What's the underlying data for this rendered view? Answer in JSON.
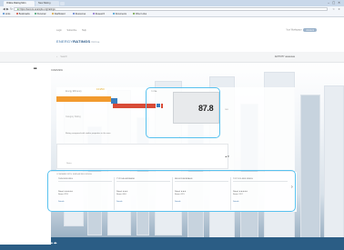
{
  "browser": {
    "tabs": [
      {
        "label": "Online Rating Mon"
      },
      {
        "label": "New Rating"
      }
    ],
    "url": "https://secure.example.org/ratings",
    "bookmarks": [
      {
        "label": "Links",
        "color": "#4a8bd1"
      },
      {
        "label": "Bookmarks",
        "color": "#d24a3a"
      },
      {
        "label": "Personal",
        "color": "#3aa26a"
      },
      {
        "label": "Dashboard",
        "color": "#d6a13a"
      },
      {
        "label": "Resources",
        "color": "#5a7bd1"
      },
      {
        "label": "Research",
        "color": "#8a6ad1"
      },
      {
        "label": "Documents",
        "color": "#3a9ad1"
      },
      {
        "label": "Other Links",
        "color": "#6aa23a"
      }
    ]
  },
  "header": {
    "toplinks": [
      "Login",
      "Subscribe",
      "Help"
    ],
    "user_text": "Your Workspace",
    "user_button": "Account",
    "logo_main": "ENERGY",
    "logo_bold": "RATINGS",
    "logo_suffix": "Online"
  },
  "search": {
    "placeholder": "Search",
    "rating_label": "ACTIVITY ★★★★★"
  },
  "rail": {
    "label": "OVERVIEW"
  },
  "score": {
    "scale": "0.0  25.0",
    "tag": "TOTAL",
    "value": "87.8",
    "value_suffix": "/100",
    "left_label": "Energy Efficiency",
    "category_label": "Category Rating"
  },
  "progress": {
    "orange_fraction": 0.23,
    "red_fraction": 0.21
  },
  "compare": {
    "text": "Rating compared with similar properties in the area",
    "marker": "▲",
    "note_label": "Notes"
  },
  "table": {
    "title": "COMPARE WITH SIMILAR BUILDINGS",
    "columns": [
      {
        "header": "THIS BUILDING",
        "line1": "Rated: ★★★★★",
        "line2": "Score: 87.8",
        "link": "Details"
      },
      {
        "header": "TYPICAL AVERAGE",
        "line1": "Rated: ★★★",
        "line2": "Score: 64.0",
        "link": "Details"
      },
      {
        "header": "REGION AVERAGE",
        "line1": "Rated: ★★★",
        "line2": "Score: 61.5",
        "link": "Details"
      },
      {
        "header": "TOP 10% BUILDINGS",
        "line1": "Rated: ★★★★★",
        "line2": "Score: 91.2",
        "link": "Details"
      }
    ]
  },
  "colors": {
    "accent": "#59c2ef",
    "orange": "#f29a2e",
    "red": "#d84b37",
    "blue": "#3a7fbf"
  }
}
